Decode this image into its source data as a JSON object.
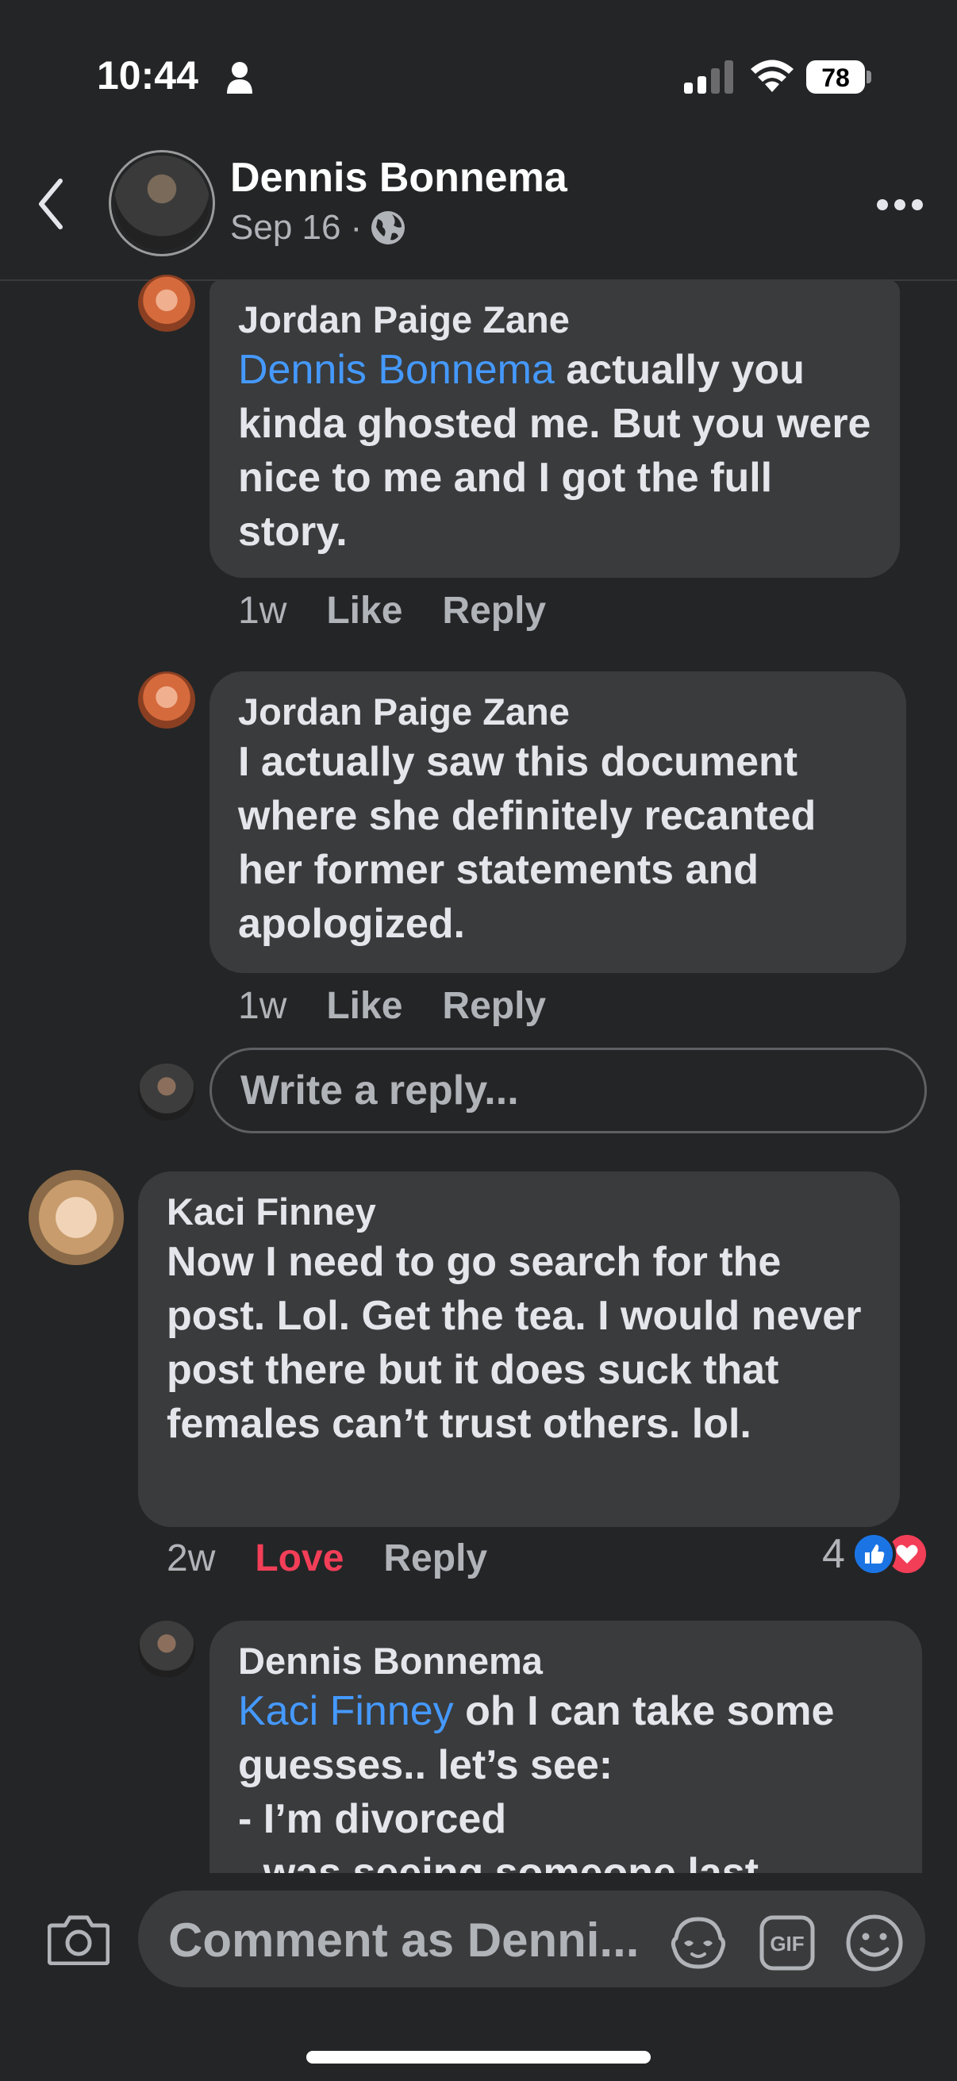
{
  "status_bar": {
    "time": "10:44",
    "battery": "78"
  },
  "header": {
    "name": "Dennis Bonnema",
    "date": "Sep 16",
    "separator": "·"
  },
  "comments": [
    {
      "author": "Jordan Paige Zane",
      "mention": "Dennis Bonnema",
      "text": "actually you kinda ghosted me. But you were nice to me and I got the full story.",
      "age": "1w",
      "like": "Like",
      "reply": "Reply"
    },
    {
      "author": "Jordan Paige Zane",
      "text": "I actually saw this document where she definitely recanted her former statements and apologized.",
      "age": "1w",
      "like": "Like",
      "reply": "Reply"
    },
    {
      "author": "Kaci Finney",
      "text": "Now I need to go search for the post. Lol. Get the tea. I would never post there but it does suck that females can’t trust others. lol.",
      "age": "2w",
      "like": "Love",
      "reply": "Reply",
      "reaction_count": "4"
    },
    {
      "author": "Dennis Bonnema",
      "mention": "Kaci Finney",
      "text_line1": "oh I can take some",
      "text_line2": "guesses.. let’s see:",
      "text_line3": "- I’m divorced",
      "text_line4": "- was seeing someone last"
    }
  ],
  "reply_box": {
    "placeholder": "Write a reply..."
  },
  "composer": {
    "placeholder": "Comment as Denni...",
    "gif_label": "GIF"
  },
  "colors": {
    "background": "#242526",
    "bubble": "#3a3b3c",
    "mention": "#4599ff",
    "love": "#f33e58",
    "like_blue": "#1b74e4"
  }
}
